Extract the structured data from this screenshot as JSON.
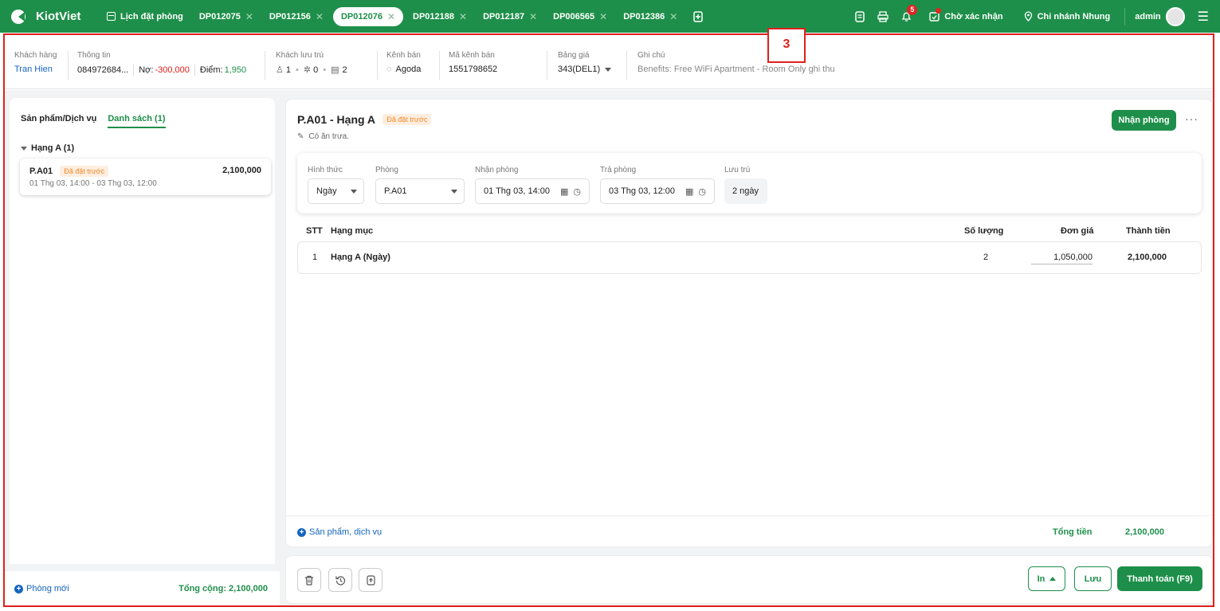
{
  "topbar": {
    "brand": "KiotViet",
    "booking_calendar": "Lịch đặt phòng",
    "tabs": [
      {
        "label": "DP012075",
        "active": false
      },
      {
        "label": "DP012156",
        "active": false
      },
      {
        "label": "DP012076",
        "active": true
      },
      {
        "label": "DP012188",
        "active": false
      },
      {
        "label": "DP012187",
        "active": false
      },
      {
        "label": "DP006565",
        "active": false
      },
      {
        "label": "DP012386",
        "active": false
      }
    ],
    "notification_count": "5",
    "pending_confirm": "Chờ xác nhận",
    "branch": "Chi nhánh Nhung",
    "user": "admin",
    "accent_color": "#1e8f4a"
  },
  "annotation_number": "3",
  "info": {
    "customer_label": "Khách hàng",
    "customer_name": "Tran Hien",
    "info_label": "Thông tin",
    "phone": "084972684...",
    "debt_label": "Nợ:",
    "debt_value": "-300,000",
    "points_label": "Điểm:",
    "points_value": "1,950",
    "guests_label": "Khách lưu trú",
    "adults": "1",
    "children": "0",
    "ids": "2",
    "channel_label": "Kênh bán",
    "channel": "Agoda",
    "channel_code_label": "Mã kênh bán",
    "channel_code": "1551798652",
    "price_list_label": "Bảng giá",
    "price_list": "343(DEL1)",
    "note_label": "Ghi chú",
    "note": "Benefits: Free WiFi Apartment - Room Only ghi thu"
  },
  "left": {
    "tab_products": "Sản phẩm/Dịch vụ",
    "tab_list": "Danh sách (1)",
    "group": "Hạng A (1)",
    "room_code": "P.A01",
    "room_status": "Đã đặt trước",
    "room_amount": "2,100,000",
    "room_dates": "01 Thg 03, 14:00 - 03 Thg 03, 12:00",
    "new_room": "Phòng mới",
    "total": "Tổng cộng: 2,100,000"
  },
  "main": {
    "title": "P.A01 - Hạng A",
    "status": "Đã đặt trước",
    "note": "Có ăn trưa.",
    "checkin_button": "Nhận phòng",
    "form": {
      "type_label": "Hình thức",
      "type_value": "Ngày",
      "room_label": "Phòng",
      "room_value": "P.A01",
      "checkin_label": "Nhận phòng",
      "checkin_value": "01 Thg 03, 14:00",
      "checkout_label": "Trả phòng",
      "checkout_value": "03 Thg 03, 12:00",
      "stay_label": "Lưu trú",
      "stay_value": "2 ngày"
    },
    "table": {
      "headers": {
        "stt": "STT",
        "item": "Hạng mục",
        "qty": "Số lượng",
        "price": "Đơn giá",
        "total": "Thành tiền"
      },
      "rows": [
        {
          "stt": "1",
          "item": "Hạng A (Ngày)",
          "qty": "2",
          "price": "1,050,000",
          "total": "2,100,000"
        }
      ]
    },
    "add_service": "Sản phẩm, dịch vụ",
    "grand_total_label": "Tổng tiền",
    "grand_total": "2,100,000"
  },
  "actions": {
    "print": "In",
    "save": "Lưu",
    "pay": "Thanh toán (F9)"
  }
}
